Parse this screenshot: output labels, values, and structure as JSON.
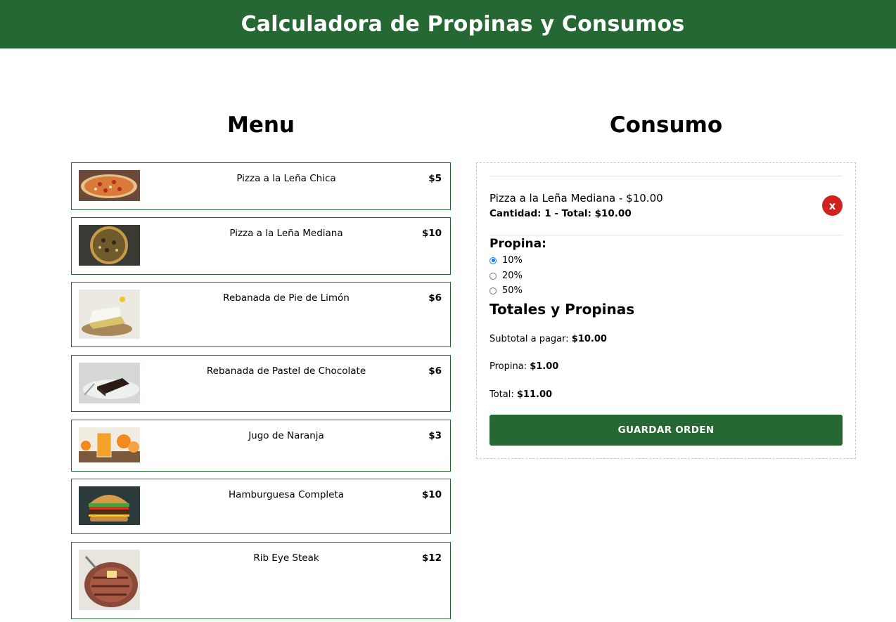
{
  "header": {
    "title": "Calculadora de Propinas y Consumos"
  },
  "menu": {
    "title": "Menu",
    "items": [
      {
        "name": "Pizza a la Leña Chica",
        "price": "$5",
        "image": "pizza-image"
      },
      {
        "name": "Pizza a la Leña Mediana",
        "price": "$10",
        "image": "pizza-image"
      },
      {
        "name": "Rebanada de Pie de Limón",
        "price": "$6",
        "image": "lemon-pie-image"
      },
      {
        "name": "Rebanada de Pastel de Chocolate",
        "price": "$6",
        "image": "chocolate-cake-image"
      },
      {
        "name": "Jugo de Naranja",
        "price": "$3",
        "image": "orange-juice-image"
      },
      {
        "name": "Hamburguesa Completa",
        "price": "$10",
        "image": "burger-image"
      },
      {
        "name": "Rib Eye Steak",
        "price": "$12",
        "image": "steak-image"
      }
    ]
  },
  "consumo": {
    "title": "Consumo",
    "order": {
      "name": "Pizza a la Leña Mediana - $10.00",
      "qty": "Cantidad: 1 - Total: $10.00",
      "remove_label": "x"
    },
    "tip": {
      "heading": "Propina:",
      "options": [
        {
          "label": "10%",
          "checked": true
        },
        {
          "label": "20%",
          "checked": false
        },
        {
          "label": "50%",
          "checked": false
        }
      ]
    },
    "totals": {
      "heading": "Totales y Propinas",
      "subtotal_label": "Subtotal a pagar:",
      "subtotal_value": "$10.00",
      "tip_label": "Propina:",
      "tip_value": "$1.00",
      "total_label": "Total:",
      "total_value": "$11.00"
    },
    "save_label": "GUARDAR ORDEN"
  },
  "colors": {
    "brand": "#256833",
    "danger": "#d02121",
    "radio": "#1a73e8"
  }
}
